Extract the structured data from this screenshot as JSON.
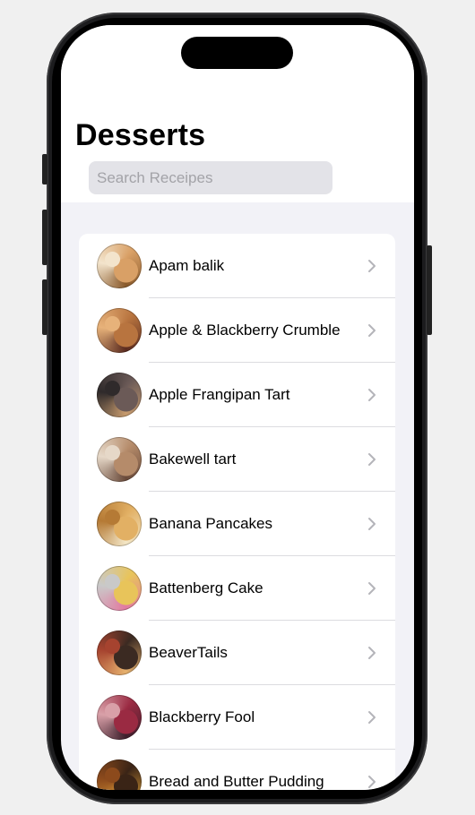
{
  "page": {
    "title": "Desserts"
  },
  "search": {
    "placeholder": "Search Receipes",
    "value": ""
  },
  "recipes": [
    {
      "name": "Apam balik",
      "colors": [
        "#d9a066",
        "#8a5a2b",
        "#f3e4cc"
      ]
    },
    {
      "name": "Apple & Blackberry Crumble",
      "colors": [
        "#b8743f",
        "#5b2b1f",
        "#e7b27a"
      ]
    },
    {
      "name": "Apple Frangipan Tart",
      "colors": [
        "#6b5a57",
        "#c79b6e",
        "#2f2a2b"
      ]
    },
    {
      "name": "Bakewell tart",
      "colors": [
        "#b58b6a",
        "#6a4a3a",
        "#e6d8c8"
      ]
    },
    {
      "name": "Banana Pancakes",
      "colors": [
        "#e2b064",
        "#f3e6c6",
        "#b57a35"
      ]
    },
    {
      "name": "Battenberg Cake",
      "colors": [
        "#e8c45a",
        "#e27aa0",
        "#c9c9c9"
      ]
    },
    {
      "name": "BeaverTails",
      "colors": [
        "#3b2a22",
        "#e6b16e",
        "#a6432f"
      ]
    },
    {
      "name": "Blackberry Fool",
      "colors": [
        "#9a2a42",
        "#3d1f2c",
        "#d9a0a8"
      ]
    },
    {
      "name": "Bread and Butter Pudding",
      "colors": [
        "#3a2416",
        "#e0a23a",
        "#8c4a1c"
      ]
    }
  ]
}
